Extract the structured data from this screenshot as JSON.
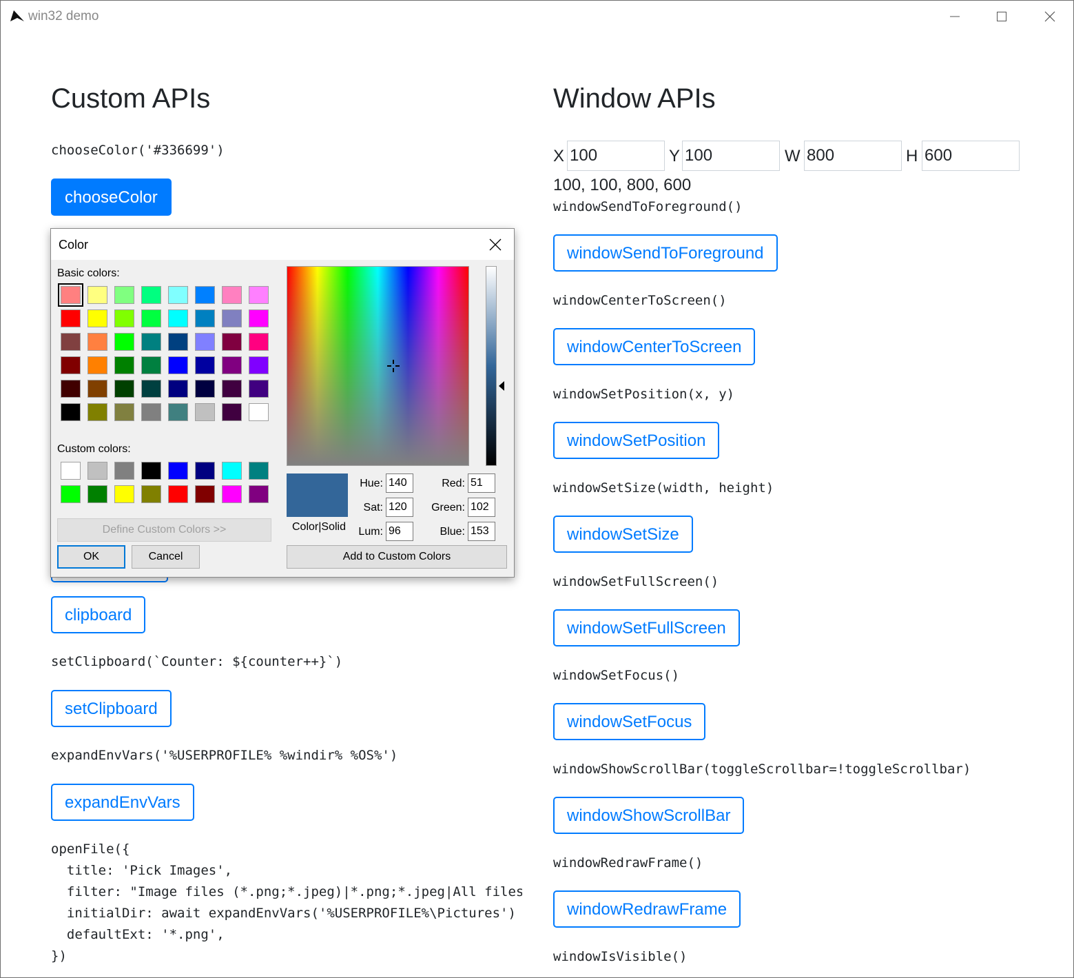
{
  "window": {
    "title": "win32 demo",
    "minimize_glyph": "—",
    "maximize_glyph": "☐",
    "close_glyph": "✕"
  },
  "custom": {
    "heading": "Custom APIs",
    "choose_color_code": "chooseColor('#336699')",
    "choose_color_button": "chooseColor",
    "clipboard_button": "clipboard",
    "set_clipboard_code": "setClipboard(`Counter: ${counter++}`)",
    "set_clipboard_button": "setClipboard",
    "expand_env_code": "expandEnvVars('%USERPROFILE% %windir% %OS%')",
    "expand_env_button": "expandEnvVars",
    "open_file_code": [
      "openFile({",
      "  title: 'Pick Images',",
      "  filter: \"Image files (*.png;*.jpeg)|*.png;*.jpeg|All files",
      "  initialDir: await expandEnvVars('%USERPROFILE%\\Pictures')",
      "  defaultExt: '*.png',",
      "})"
    ]
  },
  "window_apis": {
    "heading": "Window APIs",
    "x_label": "X",
    "x_value": "100",
    "y_label": "Y",
    "y_value": "100",
    "w_label": "W",
    "w_value": "800",
    "h_label": "H",
    "h_value": "600",
    "bounds_text": "100, 100, 800, 600",
    "items": [
      {
        "code": "windowSendToForeground()",
        "button": "windowSendToForeground"
      },
      {
        "code": "windowCenterToScreen()",
        "button": "windowCenterToScreen"
      },
      {
        "code": "windowSetPosition(x, y)",
        "button": "windowSetPosition"
      },
      {
        "code": "windowSetSize(width, height)",
        "button": "windowSetSize"
      },
      {
        "code": "windowSetFullScreen()",
        "button": "windowSetFullScreen"
      },
      {
        "code": "windowSetFocus()",
        "button": "windowSetFocus"
      },
      {
        "code": "windowShowScrollBar(toggleScrollbar=!toggleScrollbar)",
        "button": "windowShowScrollBar"
      },
      {
        "code": "windowRedrawFrame()",
        "button": "windowRedrawFrame"
      },
      {
        "code": "windowIsVisible()",
        "button": null
      }
    ]
  },
  "color_dialog": {
    "title": "Color",
    "basic_colors_label": "Basic colors:",
    "custom_colors_label": "Custom colors:",
    "basic_colors": [
      [
        "#ff8080",
        "#ffff80",
        "#80ff80",
        "#00ff80",
        "#80ffff",
        "#0080ff",
        "#ff80c0",
        "#ff80ff"
      ],
      [
        "#ff0000",
        "#ffff00",
        "#80ff00",
        "#00ff40",
        "#00ffff",
        "#0080c0",
        "#8080c0",
        "#ff00ff"
      ],
      [
        "#804040",
        "#ff8040",
        "#00ff00",
        "#008080",
        "#004080",
        "#8080ff",
        "#800040",
        "#ff0080"
      ],
      [
        "#800000",
        "#ff8000",
        "#008000",
        "#008040",
        "#0000ff",
        "#0000a0",
        "#800080",
        "#8000ff"
      ],
      [
        "#400000",
        "#804000",
        "#004000",
        "#004040",
        "#000080",
        "#000040",
        "#400040",
        "#400080"
      ],
      [
        "#000000",
        "#808000",
        "#808040",
        "#808080",
        "#408080",
        "#c0c0c0",
        "#400040",
        "#ffffff"
      ]
    ],
    "custom_colors": [
      [
        "#ffffff",
        "#c0c0c0",
        "#808080",
        "#000000",
        "#0000ff",
        "#000080",
        "#00ffff",
        "#008080"
      ],
      [
        "#00ff00",
        "#008000",
        "#ffff00",
        "#808000",
        "#ff0000",
        "#800000",
        "#ff00ff",
        "#800080"
      ]
    ],
    "selected_color": "#336699",
    "define_custom_button": "Define Custom Colors >>",
    "ok_button": "OK",
    "cancel_button": "Cancel",
    "color_solid_label": "Color|Solid",
    "hue_label": "Hue:",
    "hue_value": "140",
    "sat_label": "Sat:",
    "sat_value": "120",
    "lum_label": "Lum:",
    "lum_value": "96",
    "red_label": "Red:",
    "red_value": "51",
    "green_label": "Green:",
    "green_value": "102",
    "blue_label": "Blue:",
    "blue_value": "153",
    "add_custom_button": "Add to Custom Colors"
  }
}
